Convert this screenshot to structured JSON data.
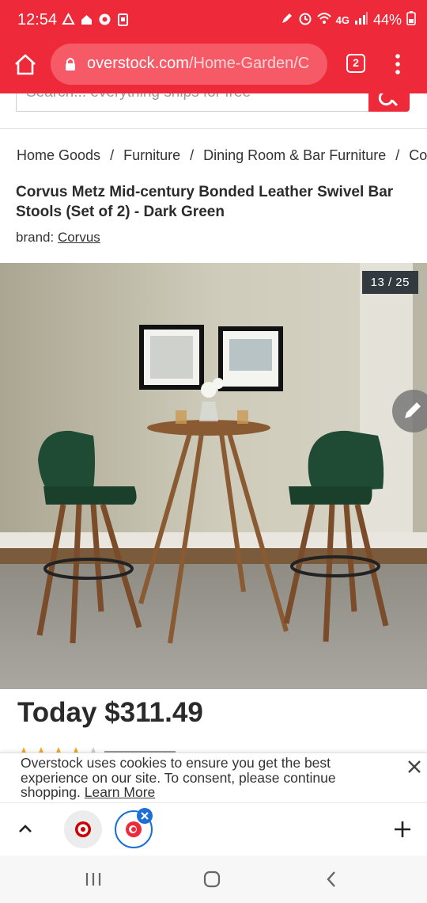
{
  "status_bar": {
    "time": "12:54",
    "network": "4G",
    "battery": "44%"
  },
  "browser": {
    "url_host": "overstock.com",
    "url_path": "/Home-Garden/C",
    "tab_count": "2"
  },
  "search": {
    "placeholder": "Search... everything ships for free"
  },
  "breadcrumb": {
    "items": [
      "Home Goods",
      "Furniture",
      "Dining Room & Bar Furniture",
      "Co"
    ],
    "separator": "/"
  },
  "product": {
    "title": "Corvus Metz Mid-century Bonded Leather Swivel Bar Stools (Set of 2) - Dark Green",
    "brand_label": "brand:",
    "brand_name": "Corvus",
    "image_counter": "13 / 25",
    "price": "Today $311.49"
  },
  "cookie_banner": {
    "text": "Overstock uses cookies to ensure you get the best experience on our site. To consent, please continue shopping.",
    "link": "Learn More"
  },
  "colors": {
    "brand_red": "#ee2a3a",
    "tab_blue": "#1b6fd6"
  },
  "icons": {
    "home": "home-icon",
    "lock": "lock-icon",
    "tabs": "tabs-icon",
    "menu": "more-vert-icon",
    "search": "search-icon",
    "edit": "pencil-icon",
    "close": "close-icon",
    "chevron_up": "chevron-up-icon",
    "plus": "plus-icon"
  }
}
